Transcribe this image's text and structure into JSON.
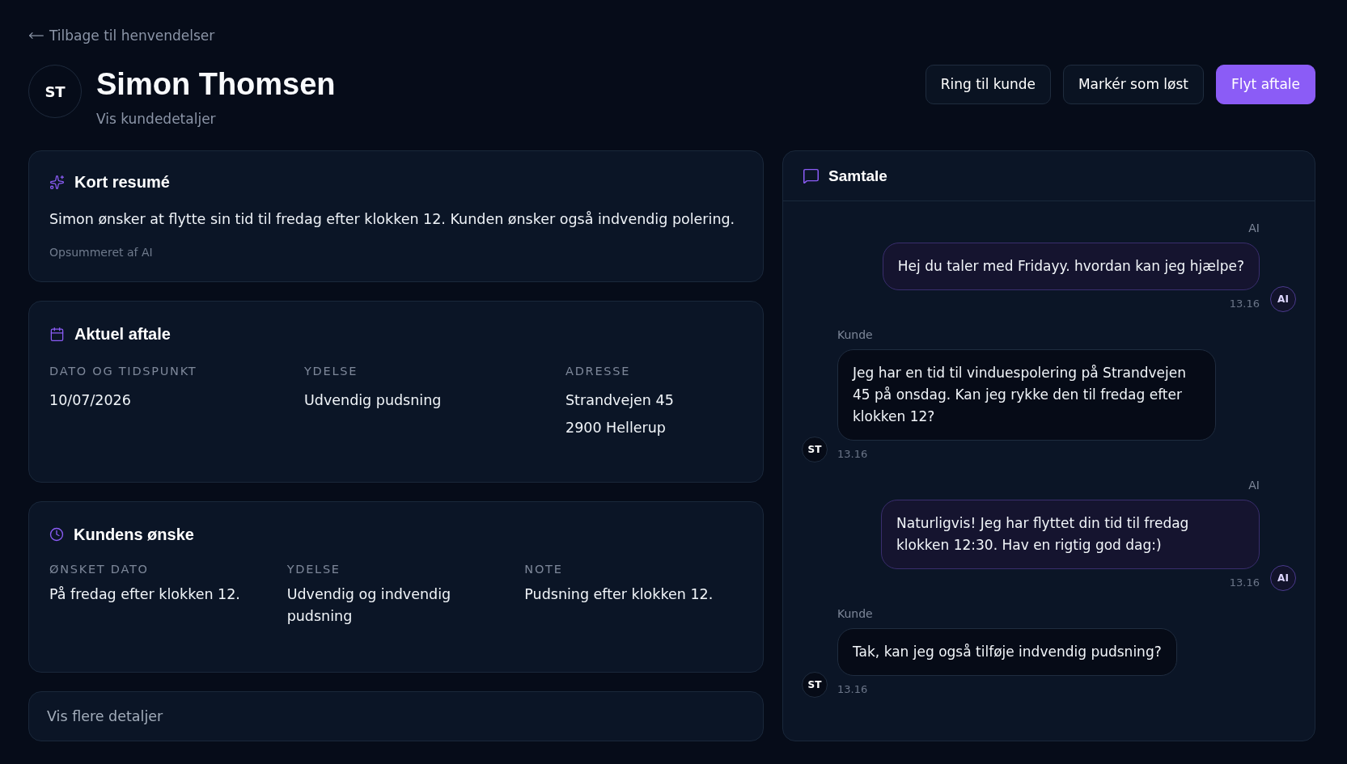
{
  "back_link": {
    "label": "Tilbage til henvendelser"
  },
  "customer": {
    "initials": "ST",
    "name": "Simon Thomsen",
    "details_link": "Vis kundedetaljer"
  },
  "actions": [
    {
      "label": "Ring til kunde",
      "kind": "secondary"
    },
    {
      "label": "Markér som løst",
      "kind": "secondary"
    },
    {
      "label": "Flyt aftale",
      "kind": "primary"
    }
  ],
  "summary": {
    "title": "Kort resumé",
    "text": "Simon ønsker at flytte sin tid til fredag efter klokken 12. Kunden ønsker også indvendig polering.",
    "footnote": "Opsummeret af AI"
  },
  "current_appointment": {
    "title": "Aktuel aftale",
    "fields": [
      {
        "label": "DATO OG TIDSPUNKT",
        "lines": [
          "10/07/2026"
        ]
      },
      {
        "label": "YDELSE",
        "lines": [
          "Udvendig pudsning"
        ]
      },
      {
        "label": "ADRESSE",
        "lines": [
          "Strandvejen 45",
          "2900 Hellerup"
        ]
      }
    ]
  },
  "customer_request": {
    "title": "Kundens ønske",
    "fields": [
      {
        "label": "ØNSKET DATO",
        "value": "På fredag efter klokken 12."
      },
      {
        "label": "YDELSE",
        "value": "Udvendig og indvendig pudsning"
      },
      {
        "label": "NOTE",
        "value": "Pudsning efter klokken 12."
      }
    ]
  },
  "more_details": {
    "label": "Vis flere detaljer"
  },
  "conversation": {
    "title": "Samtale",
    "messages": [
      {
        "kind": "ai",
        "sender": "AI",
        "avatar": "AI",
        "text": "Hej du taler med Fridayy. hvordan kan jeg hjælpe?",
        "time": "13.16"
      },
      {
        "kind": "customer",
        "sender": "Kunde",
        "avatar": "ST",
        "text": "Jeg har en tid til vinduespolering på Strandvejen 45 på onsdag. Kan jeg rykke den til fredag efter klokken 12?",
        "time": "13.16"
      },
      {
        "kind": "ai",
        "sender": "AI",
        "avatar": "AI",
        "text": "Naturligvis! Jeg har flyttet din tid til fredag klokken 12:30. Hav en rigtig god dag:)",
        "time": "13.16"
      },
      {
        "kind": "customer",
        "sender": "Kunde",
        "avatar": "ST",
        "text": "Tak, kan jeg også tilføje indvendig pudsning?",
        "time": "13.16"
      }
    ]
  }
}
